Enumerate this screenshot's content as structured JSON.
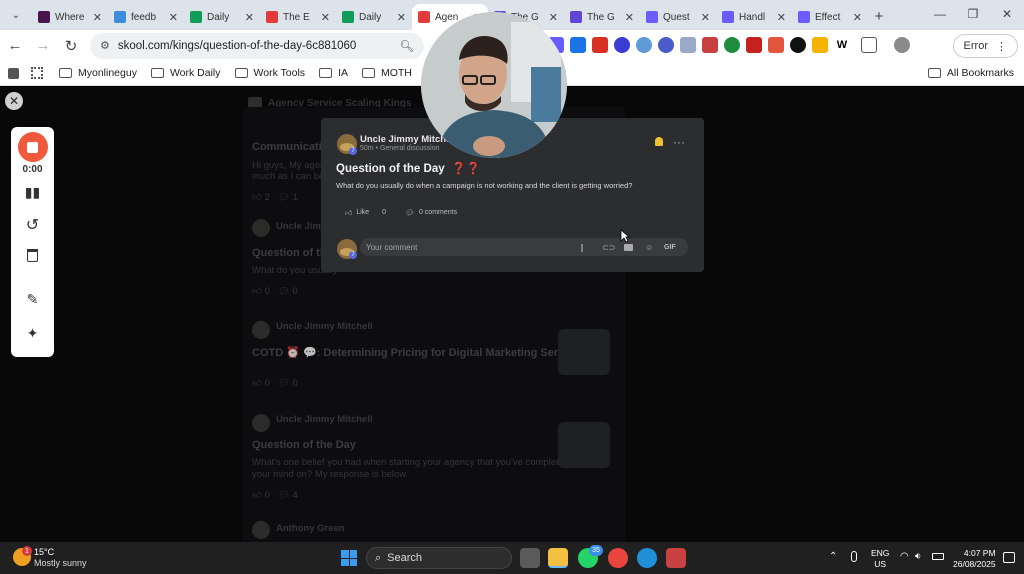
{
  "browser": {
    "tabs": [
      {
        "label": "Where",
        "icon": "slack-icon",
        "color": "#4a154b"
      },
      {
        "label": "feedb",
        "icon": "feedback-icon",
        "color": "#3c8ddc"
      },
      {
        "label": "Daily",
        "icon": "sheets-icon",
        "color": "#0f9d58"
      },
      {
        "label": "The E",
        "icon": "skool-icon",
        "color": "#e03a3a"
      },
      {
        "label": "Daily",
        "icon": "sheets-icon",
        "color": "#0f9d58"
      },
      {
        "label": "Agen",
        "icon": "skool-icon",
        "color": "#e03a3a"
      },
      {
        "label": "The G",
        "icon": "doc-icon",
        "color": "#5f44d6"
      },
      {
        "label": "The G",
        "icon": "doc-icon",
        "color": "#5f44d6"
      },
      {
        "label": "Quest",
        "icon": "gear-icon",
        "color": "#6b5cff"
      },
      {
        "label": "Handl",
        "icon": "gear-icon",
        "color": "#6b5cff"
      },
      {
        "label": "Effect",
        "icon": "gear-icon",
        "color": "#6b5cff"
      }
    ],
    "active_tab_index": 5,
    "url": "skool.com/kings/question-of-the-day-6c881060",
    "error_label": "Error",
    "bookmarks": [
      "Myonlineguy",
      "Work Daily",
      "Work Tools",
      "IA",
      "MOTH"
    ],
    "all_bookmarks_label": "All Bookmarks"
  },
  "page": {
    "group_name": "Agency Service Scaling Kings",
    "feed": [
      {
        "author": "",
        "title": "Communication",
        "meta": "",
        "excerpt": "Hi guys, My agency",
        "excerpt2": "much as I can befor",
        "likes": "2",
        "comments": "1"
      },
      {
        "author": "Uncle Jimmy Mitchell",
        "title": "Question of the",
        "meta": "",
        "excerpt": "What do you usually",
        "likes": "0",
        "comments": "0"
      },
      {
        "author": "Uncle Jimmy Mitchell",
        "title": "COTD ⏰ 💬: Determining Pricing for Digital Marketing Services",
        "meta": "",
        "excerpt": "",
        "likes": "0",
        "comments": "0"
      },
      {
        "author": "Uncle Jimmy Mitchell",
        "title": "Question of the Day",
        "meta": "",
        "excerpt": "What's one belief you had when starting your agency that you've completely changed",
        "excerpt2": "your mind on? My response is below",
        "likes": "0",
        "comments": "4"
      },
      {
        "author": "Anthony Green",
        "title": "",
        "meta": "",
        "excerpt": "",
        "likes": "",
        "comments": ""
      }
    ]
  },
  "modal": {
    "author": "Uncle Jimmy Mitchell",
    "meta": "50m • General discussion",
    "level": "7",
    "title": "Question of the Day",
    "title_emoji": "❓❓",
    "body": "What do you usually do when a campaign is not working and the client is getting worried?",
    "like_label": "Like",
    "like_count": "0",
    "comments_label": "0 comments",
    "comment_placeholder": "Your comment",
    "gif_label": "GIF"
  },
  "recorder": {
    "timer": "0:00"
  },
  "taskbar": {
    "temperature": "15°C",
    "weather": "Mostly sunny",
    "weather_badge": "1",
    "search_label": "Search",
    "whatsapp_badge": "35",
    "lang": "ENG",
    "region": "US",
    "time": "4:07 PM",
    "date": "26/08/2025"
  }
}
